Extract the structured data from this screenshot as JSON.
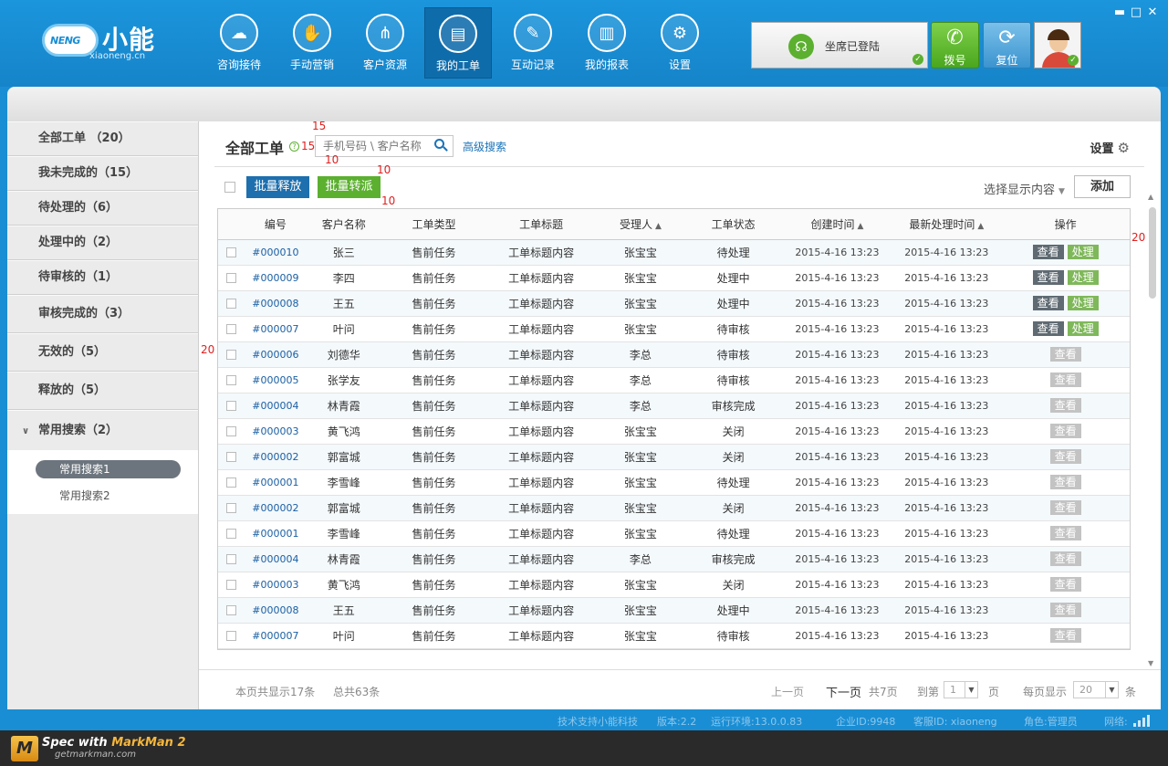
{
  "app": {
    "logo_badge": "NENG",
    "logo_title": "小能",
    "logo_sub": "xiaoneng.cn",
    "window_controls": [
      "▬",
      "□",
      "✕"
    ]
  },
  "nav": [
    {
      "label": "咨询接待",
      "icon": "chat-icon",
      "glyph": "☁"
    },
    {
      "label": "手动营销",
      "icon": "handshake-icon",
      "glyph": "✋"
    },
    {
      "label": "客户资源",
      "icon": "share-icon",
      "glyph": "⋔"
    },
    {
      "label": "我的工单",
      "icon": "document-icon",
      "glyph": "▤"
    },
    {
      "label": "互动记录",
      "icon": "pencil-icon",
      "glyph": "✎"
    },
    {
      "label": "我的报表",
      "icon": "chart-icon",
      "glyph": "▥"
    },
    {
      "label": "设置",
      "icon": "gear-icon",
      "glyph": "⚙"
    }
  ],
  "agent": {
    "status_text": "坐席已登陆",
    "dial_label": "拨号",
    "reset_label": "复位"
  },
  "sidebar": {
    "items": [
      {
        "label": "全部工单 （20）"
      },
      {
        "label": "我未完成的（15）"
      },
      {
        "label": "待处理的（6）"
      },
      {
        "label": "处理中的（2）"
      },
      {
        "label": "待审核的（1）"
      },
      {
        "label": "审核完成的（3）"
      },
      {
        "label": "无效的（5）"
      },
      {
        "label": "释放的（5）"
      }
    ],
    "group_label": "常用搜索（2）",
    "sub_items": [
      "常用搜索1",
      "常用搜索2"
    ]
  },
  "main": {
    "title": "全部工单",
    "search_placeholder": "手机号码 \\ 客户名称",
    "advanced_search": "高级搜索",
    "settings_label": "设置",
    "batch_release": "批量释放",
    "batch_transfer": "批量转派",
    "display_select": "选择显示内容",
    "add_button": "添加"
  },
  "table": {
    "headers": [
      "编号",
      "客户名称",
      "工单类型",
      "工单标题",
      "受理人",
      "工单状态",
      "创建时间",
      "最新处理时间",
      "操作"
    ],
    "view_label": "查看",
    "handle_label": "处理",
    "rows": [
      {
        "id": "#000010",
        "customer": "张三",
        "type": "售前任务",
        "title": "工单标题内容",
        "assignee": "张宝宝",
        "status": "待处理",
        "created": "2015-4-16 13:23",
        "updated": "2015-4-16 13:23",
        "handle": true
      },
      {
        "id": "#000009",
        "customer": "李四",
        "type": "售前任务",
        "title": "工单标题内容",
        "assignee": "张宝宝",
        "status": "处理中",
        "created": "2015-4-16 13:23",
        "updated": "2015-4-16 13:23",
        "handle": true
      },
      {
        "id": "#000008",
        "customer": "王五",
        "type": "售前任务",
        "title": "工单标题内容",
        "assignee": "张宝宝",
        "status": "处理中",
        "created": "2015-4-16 13:23",
        "updated": "2015-4-16 13:23",
        "handle": true
      },
      {
        "id": "#000007",
        "customer": "叶问",
        "type": "售前任务",
        "title": "工单标题内容",
        "assignee": "张宝宝",
        "status": "待审核",
        "created": "2015-4-16 13:23",
        "updated": "2015-4-16 13:23",
        "handle": true
      },
      {
        "id": "#000006",
        "customer": "刘德华",
        "type": "售前任务",
        "title": "工单标题内容",
        "assignee": "李总",
        "status": "待审核",
        "created": "2015-4-16 13:23",
        "updated": "2015-4-16 13:23",
        "handle": false
      },
      {
        "id": "#000005",
        "customer": "张学友",
        "type": "售前任务",
        "title": "工单标题内容",
        "assignee": "李总",
        "status": "待审核",
        "created": "2015-4-16 13:23",
        "updated": "2015-4-16 13:23",
        "handle": false
      },
      {
        "id": "#000004",
        "customer": "林青霞",
        "type": "售前任务",
        "title": "工单标题内容",
        "assignee": "李总",
        "status": "审核完成",
        "created": "2015-4-16 13:23",
        "updated": "2015-4-16 13:23",
        "handle": false
      },
      {
        "id": "#000003",
        "customer": "黄飞鸿",
        "type": "售前任务",
        "title": "工单标题内容",
        "assignee": "张宝宝",
        "status": "关闭",
        "created": "2015-4-16 13:23",
        "updated": "2015-4-16 13:23",
        "handle": false
      },
      {
        "id": "#000002",
        "customer": "郭富城",
        "type": "售前任务",
        "title": "工单标题内容",
        "assignee": "张宝宝",
        "status": "关闭",
        "created": "2015-4-16 13:23",
        "updated": "2015-4-16 13:23",
        "handle": false
      },
      {
        "id": "#000001",
        "customer": "李雪峰",
        "type": "售前任务",
        "title": "工单标题内容",
        "assignee": "张宝宝",
        "status": "待处理",
        "created": "2015-4-16 13:23",
        "updated": "2015-4-16 13:23",
        "handle": false
      },
      {
        "id": "#000002",
        "customer": "郭富城",
        "type": "售前任务",
        "title": "工单标题内容",
        "assignee": "张宝宝",
        "status": "关闭",
        "created": "2015-4-16 13:23",
        "updated": "2015-4-16 13:23",
        "handle": false
      },
      {
        "id": "#000001",
        "customer": "李雪峰",
        "type": "售前任务",
        "title": "工单标题内容",
        "assignee": "张宝宝",
        "status": "待处理",
        "created": "2015-4-16 13:23",
        "updated": "2015-4-16 13:23",
        "handle": false
      },
      {
        "id": "#000004",
        "customer": "林青霞",
        "type": "售前任务",
        "title": "工单标题内容",
        "assignee": "李总",
        "status": "审核完成",
        "created": "2015-4-16 13:23",
        "updated": "2015-4-16 13:23",
        "handle": false
      },
      {
        "id": "#000003",
        "customer": "黄飞鸿",
        "type": "售前任务",
        "title": "工单标题内容",
        "assignee": "张宝宝",
        "status": "关闭",
        "created": "2015-4-16 13:23",
        "updated": "2015-4-16 13:23",
        "handle": false
      },
      {
        "id": "#000008",
        "customer": "王五",
        "type": "售前任务",
        "title": "工单标题内容",
        "assignee": "张宝宝",
        "status": "处理中",
        "created": "2015-4-16 13:23",
        "updated": "2015-4-16 13:23",
        "handle": false
      },
      {
        "id": "#000007",
        "customer": "叶问",
        "type": "售前任务",
        "title": "工单标题内容",
        "assignee": "张宝宝",
        "status": "待审核",
        "created": "2015-4-16 13:23",
        "updated": "2015-4-16 13:23",
        "handle": false
      }
    ]
  },
  "pager": {
    "shown_this_page": "本页共显示17条",
    "total": "总共63条",
    "prev": "上一页",
    "next": "下一页",
    "pages_total": "共7页",
    "goto_label": "到第",
    "goto_value": "1",
    "page_unit": "页",
    "per_page_label": "每页显示",
    "per_page_value": "20",
    "per_page_unit": "条"
  },
  "statusbar": {
    "support": "技术支持小能科技",
    "version": "版本:2.2",
    "env": "运行环境:13.0.0.83",
    "company_id": "企业ID:9948",
    "service_id": "客服ID: xiaoneng",
    "role": "角色:管理员",
    "network": "网络:"
  },
  "markman": {
    "spec_with": "Spec with",
    "product": "MarkMan 2",
    "site": "getmarkman.com",
    "logo_letter": "M"
  },
  "annotations": {
    "a15_top": "15",
    "a15_left": "15",
    "a10_search": "10",
    "a10_btn_right": "10",
    "a10_btn_bottom": "10",
    "a20_left": "20",
    "a20_right": "20"
  },
  "colors": {
    "header_blue": "#1a8ed4",
    "active_nav": "#0f6cab",
    "primary_button": "#1d6fae",
    "success_green": "#5cb030",
    "view_button": "#5f6a72",
    "handle_button": "#7fb85a"
  }
}
